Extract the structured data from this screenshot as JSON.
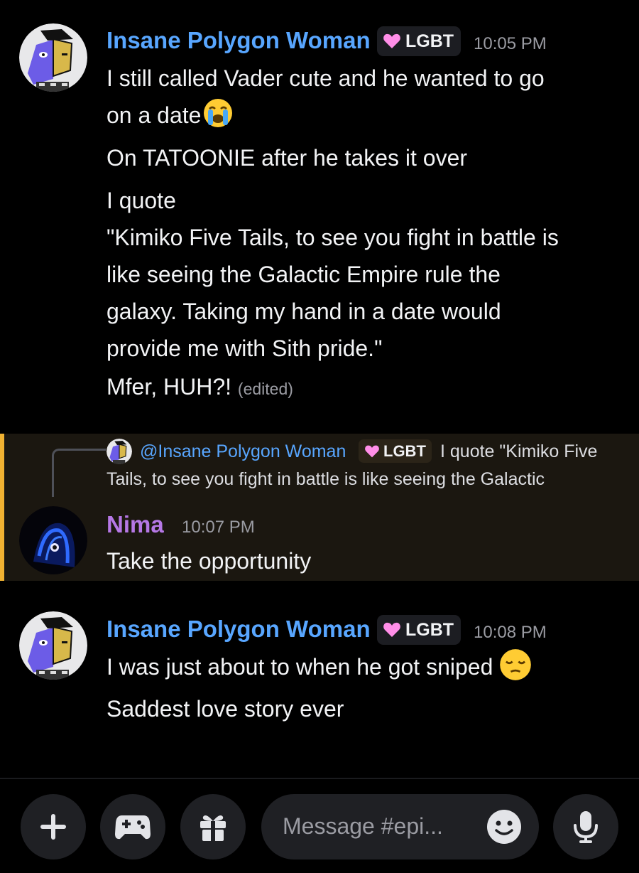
{
  "colors": {
    "user_blue": "#58a6ff",
    "user_purple": "#b678e6",
    "highlight_bar": "#f0b232",
    "tag_heart": "#ff8ee8"
  },
  "messages": [
    {
      "username": "Insane Polygon Woman",
      "role_tag": "LGBT",
      "timestamp": "10:05 PM",
      "avatar": "polygon-woman-avatar",
      "lines": [
        "I still called Vader cute and he wanted to go",
        "on a date",
        "On TATOONIE after he takes it over",
        "I quote",
        "\"Kimiko Five Tails, to see you fight in battle is",
        "like seeing the Galactic Empire rule the",
        "galaxy. Taking my hand in a date would",
        "provide me with Sith pride.\"",
        "Mfer, HUH?!"
      ],
      "edited_label": "(edited)"
    },
    {
      "reply": {
        "mention": "@Insane Polygon Woman",
        "role_tag": "LGBT",
        "preview_start": "I quote \"Kimiko Five",
        "preview_line2": "Tails, to see you fight in battle is like seeing the Galactic"
      },
      "username": "Nima",
      "timestamp": "10:07 PM",
      "avatar": "nima-avatar",
      "lines": [
        "Take the opportunity"
      ]
    },
    {
      "username": "Insane Polygon Woman",
      "role_tag": "LGBT",
      "timestamp": "10:08 PM",
      "avatar": "polygon-woman-avatar",
      "lines": [
        "I was just about to when he got sniped",
        "Saddest love story ever"
      ]
    }
  ],
  "composer": {
    "placeholder": "Message #epi...",
    "buttons": [
      "plus-icon",
      "gamepad-icon",
      "gift-icon",
      "emoji-icon",
      "microphone-icon"
    ]
  }
}
